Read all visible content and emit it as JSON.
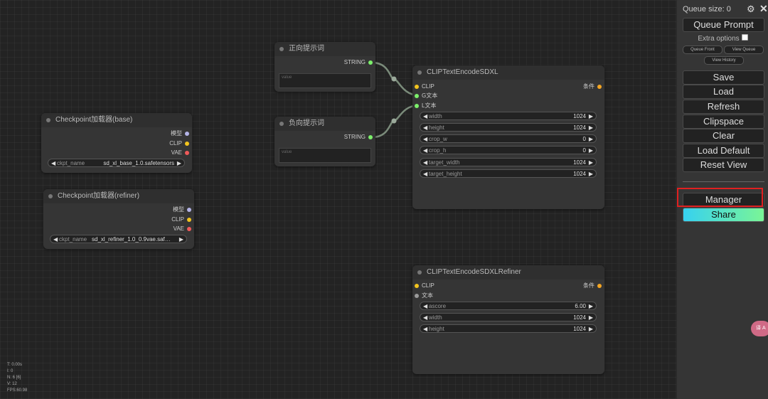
{
  "colors": {
    "clip_pin": "#f2c41e",
    "conditioning_pin": "#f5a623",
    "string_pin": "#7cf06b",
    "model_pin": "#b4b4e8",
    "vae_pin": "#f05a5a",
    "text_pin": "#9a9a9a",
    "highlight": "#e02020",
    "link": "#7a8b7a"
  },
  "nodes": {
    "positive_prompt": {
      "title": "正向提示词",
      "output": "STRING",
      "placeholder": "value"
    },
    "negative_prompt": {
      "title": "负向提示词",
      "output": "STRING",
      "placeholder": "value"
    },
    "ckpt_base": {
      "title": "Checkpoint加载器(base)",
      "outputs": [
        "模型",
        "CLIP",
        "VAE"
      ],
      "widget_label": "ckpt_name",
      "widget_value": "sd_xl_base_1.0.safetensors"
    },
    "ckpt_refiner": {
      "title": "Checkpoint加载器(refiner)",
      "outputs": [
        "模型",
        "CLIP",
        "VAE"
      ],
      "widget_label": "ckpt_name",
      "widget_value": "sd_xl_refiner_1.0_0.9vae.saf…"
    },
    "clip_sdxl": {
      "title": "CLIPTextEncodeSDXL",
      "inputs": [
        "CLIP",
        "G文本",
        "L文本"
      ],
      "output": "条件",
      "widgets": [
        {
          "label": "width",
          "value": "1024"
        },
        {
          "label": "height",
          "value": "1024"
        },
        {
          "label": "crop_w",
          "value": "0"
        },
        {
          "label": "crop_h",
          "value": "0"
        },
        {
          "label": "target_width",
          "value": "1024"
        },
        {
          "label": "target_height",
          "value": "1024"
        }
      ]
    },
    "clip_refiner": {
      "title": "CLIPTextEncodeSDXLRefiner",
      "inputs": [
        "CLIP",
        "文本"
      ],
      "output": "条件",
      "widgets": [
        {
          "label": "ascore",
          "value": "6.00"
        },
        {
          "label": "width",
          "value": "1024"
        },
        {
          "label": "height",
          "value": "1024"
        }
      ]
    }
  },
  "menu": {
    "queue_size": "Queue size: 0",
    "queue_prompt": "Queue Prompt",
    "extra_options": "Extra options",
    "queue_front": "Queue Front",
    "view_queue": "View Queue",
    "view_history": "View History",
    "save": "Save",
    "load": "Load",
    "refresh": "Refresh",
    "clipspace": "Clipspace",
    "clear": "Clear",
    "load_default": "Load Default",
    "reset_view": "Reset View",
    "manager": "Manager",
    "share": "Share"
  },
  "stats": {
    "t": "T: 0.00s",
    "i": "I: 0",
    "n": "N: 6 [6]",
    "v": "V: 12",
    "fps": "FPS:60.98"
  },
  "translate_label": "译 A"
}
